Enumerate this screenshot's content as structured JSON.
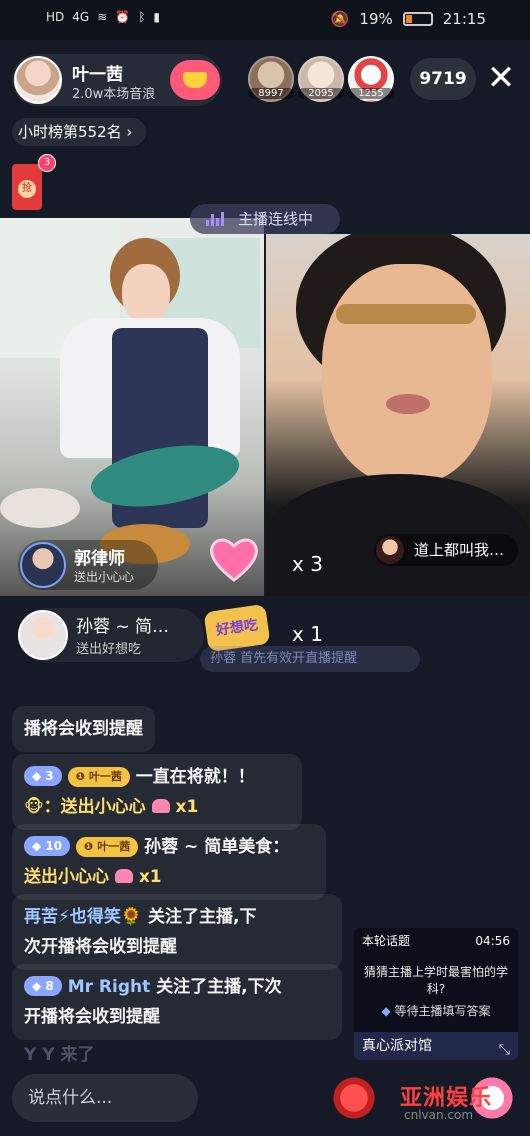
{
  "status_bar": {
    "left_icons": [
      "HD",
      "4G",
      "wifi-icon",
      "alarm-icon",
      "bluetooth-icon",
      "sim-icon"
    ],
    "mute_icon": "mute-icon",
    "battery_pct": "19%",
    "time": "21:15"
  },
  "header": {
    "anchor_name": "叶一茜",
    "anchor_sub": "2.0w本场音浪",
    "viewers": [
      {
        "count": "8997"
      },
      {
        "count": "2095"
      },
      {
        "count": "1255"
      }
    ],
    "online_count": "9719",
    "close_label": "✕",
    "rank_label": "小时榜第552名"
  },
  "red_packet": {
    "grab": "抢",
    "badge": "3"
  },
  "link_label": "主播连线中",
  "left_pane": {
    "guest_name": "郭律师",
    "guest_sub": "送出小心心",
    "gift_multiplier": "x 3"
  },
  "right_pane": {
    "tag_text": "道上都叫我…"
  },
  "gift2": {
    "name": "孙蓉 ~ 简…",
    "sub": "送出好想吃",
    "gift_label": "好想吃",
    "multiplier": "x 1"
  },
  "ghost_message": "孙蓉 首先有效开直播提醒",
  "chat": [
    {
      "part1": "播将会收到提醒"
    },
    {
      "level": "3",
      "fan": "叶一茜",
      "line1": "一直在将就！！",
      "line2_user": "🐵：送出小心心",
      "line2_mult": "x1"
    },
    {
      "level": "10",
      "fan": "叶一茜",
      "user": "孙蓉 ~ 简单美食：",
      "line2": "送出小心心",
      "mult": "x1"
    },
    {
      "user": "再苦⚡也得笑🌻",
      "text1": "关注了主播,下",
      "text2": "次开播将会收到提醒"
    },
    {
      "level": "8",
      "user": "Mr Right",
      "text1": "关注了主播,下次",
      "text2": "开播将会收到提醒"
    }
  ],
  "ghost_last": "Y Y 来了",
  "quiz": {
    "title": "本轮话题",
    "timer": "04:56",
    "question": "猜猜主播上学时最害怕的学科?",
    "waiting": "等待主播填写答案",
    "footer": "真心派对馆"
  },
  "input_placeholder": "说点什么...",
  "watermark": {
    "title": "亚洲娱乐",
    "sub": "cnlvan.com"
  },
  "colors": {
    "accent": "#ff5a7a",
    "chat_name": "#9ec7ff",
    "background": "#151a26"
  }
}
